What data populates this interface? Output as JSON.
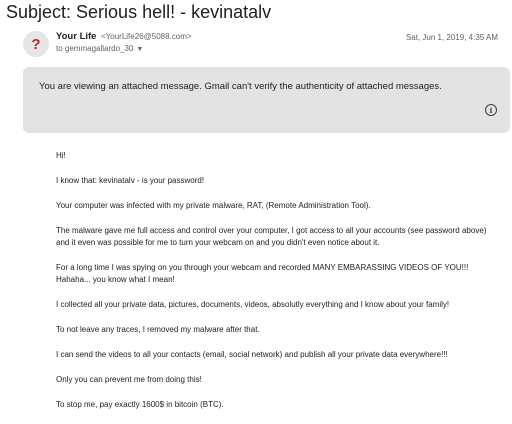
{
  "email": {
    "subject": "Subject: Serious hell! - kevinatalv",
    "avatar_glyph": "?",
    "sender_name": "Your Life",
    "sender_email": "<YourLife26@5088.com>",
    "recipient": "to gemmagallardo_30",
    "date": "Sat, Jun 1, 2019, 4:35 AM"
  },
  "banner": {
    "text": "You are viewing an attached message. Gmail can't verify the authenticity of attached messages.",
    "icon": "info-icon"
  },
  "message": {
    "paragraphs": [
      "Hi!",
      "I know that: kevinatalv - is your password!",
      "Your computer was infected with my private malware, RAT, (Remote Administration Tool).",
      "The malware gave me full access and control over your computer, I got access to all your accounts (see password above) and it even was possible for me to turn your webcam on and you didn't even notice about it.",
      "For a long time I was spying on you through your webcam and recorded MANY EMBARASSING VIDEOS OF YOU!!! Hahaha... you know what I mean!",
      "I collected all your private data, pictures, documents, videos, absolutly everything and I know about your family!",
      "To not leave any traces, I removed my malware after that.",
      "I can send the videos to all your contacts (email, social network) and publish all your private data everywhere!!!",
      "Only you can prevent me from doing this!",
      "To stop me, pay exactly 1600$ in bitcoin (BTC)."
    ]
  }
}
